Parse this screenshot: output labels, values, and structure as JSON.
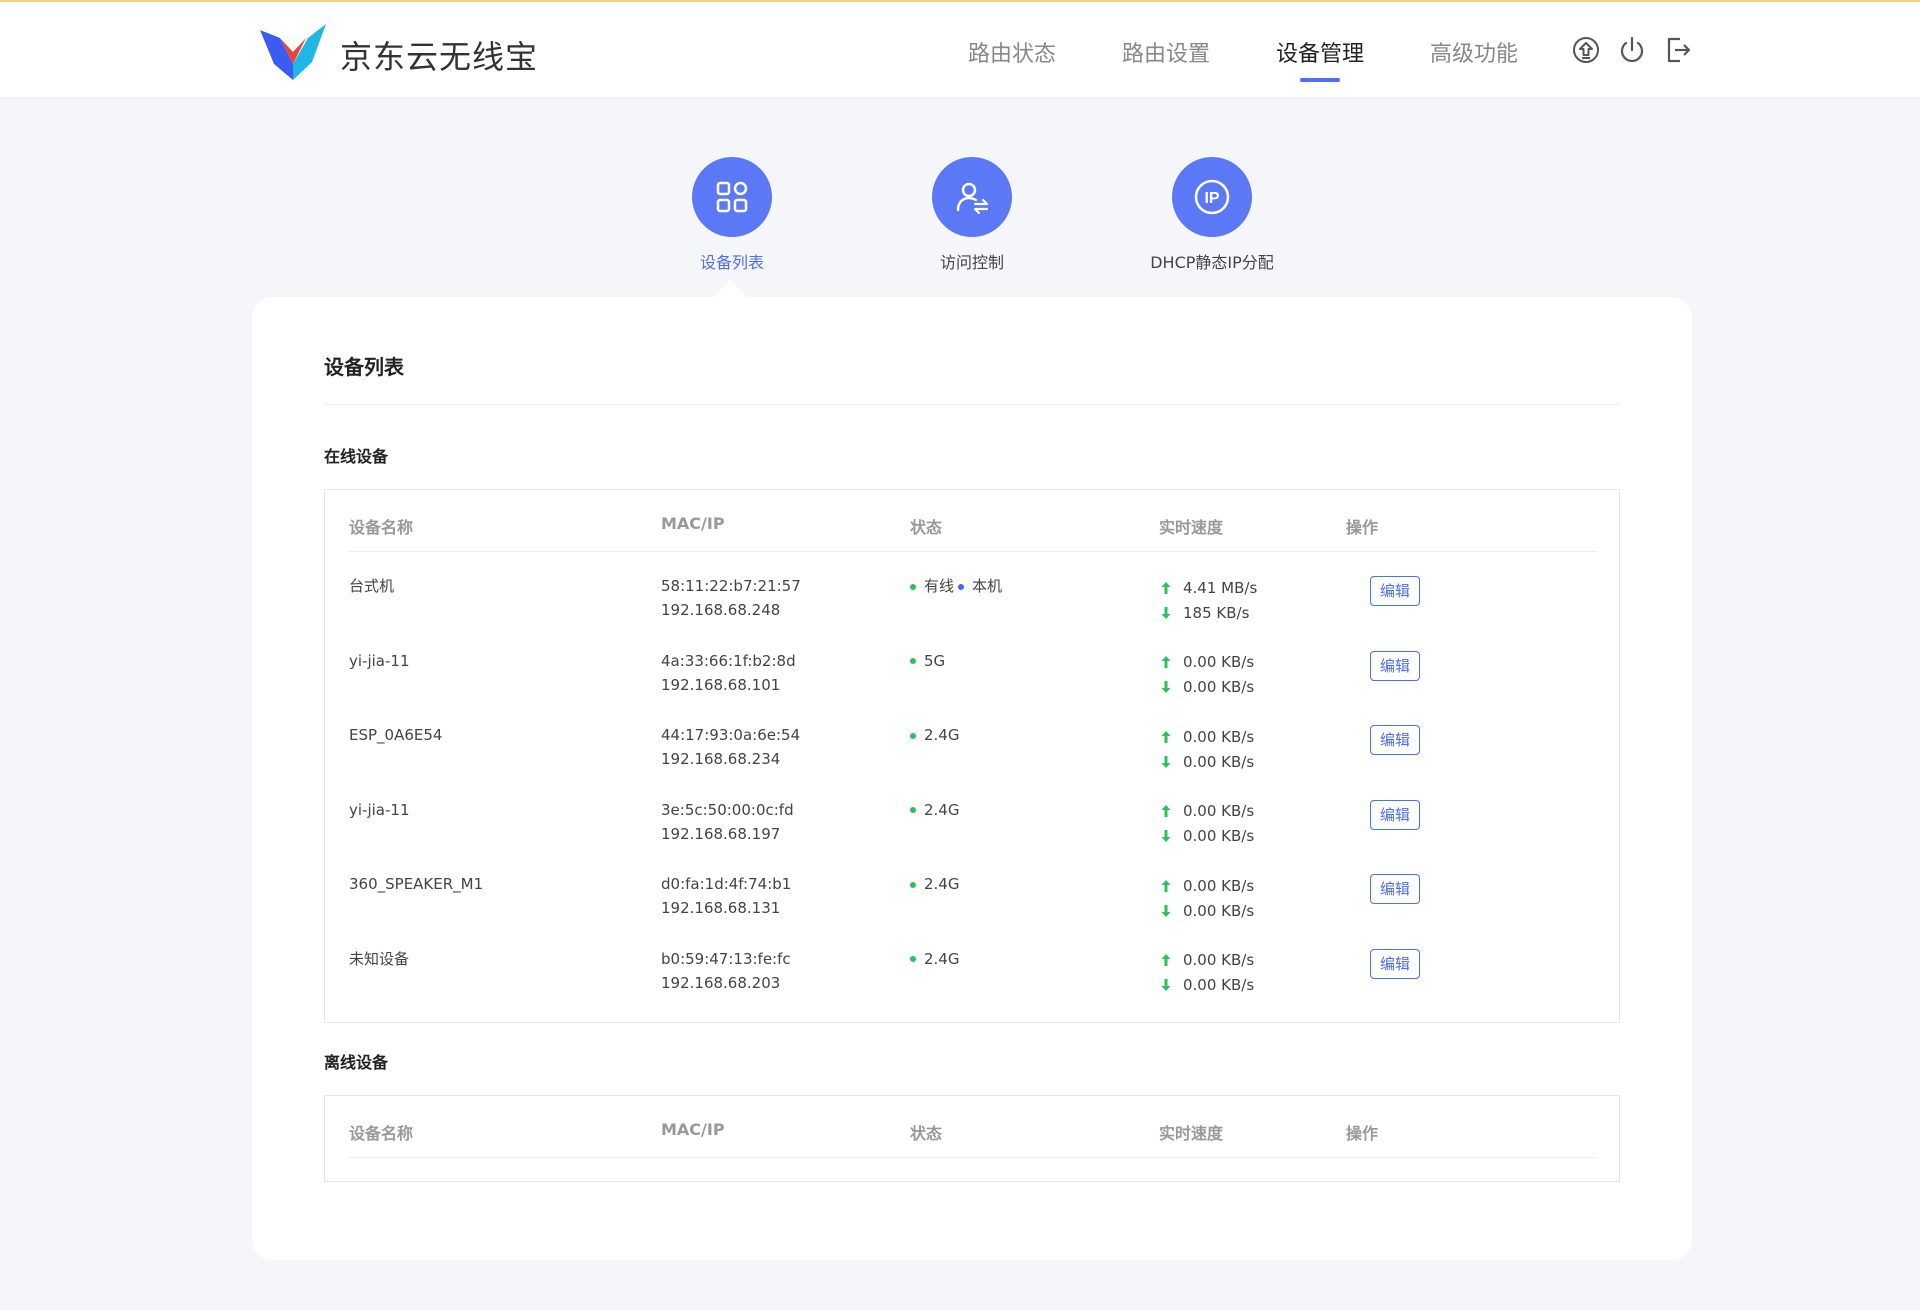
{
  "brand": {
    "name": "京东云无线宝"
  },
  "nav": {
    "items": [
      {
        "label": "路由状态",
        "active": false
      },
      {
        "label": "路由设置",
        "active": false
      },
      {
        "label": "设备管理",
        "active": true
      },
      {
        "label": "高级功能",
        "active": false
      }
    ]
  },
  "header_icons": [
    "upgrade-icon",
    "power-icon",
    "logout-icon"
  ],
  "subnav": {
    "items": [
      {
        "label": "设备列表",
        "icon": "grid-icon",
        "active": true
      },
      {
        "label": "访问控制",
        "icon": "user-switch-icon",
        "active": false
      },
      {
        "label": "DHCP静态IP分配",
        "icon": "ip-icon",
        "active": false
      }
    ]
  },
  "panel": {
    "title": "设备列表",
    "online_title": "在线设备",
    "offline_title": "离线设备",
    "columns": [
      "设备名称",
      "MAC/IP",
      "状态",
      "实时速度",
      "操作"
    ],
    "edit_label": "编辑",
    "online_devices": [
      {
        "name": "台式机",
        "mac": "58:11:22:b7:21:57",
        "ip": "192.168.68.248",
        "status": "有线",
        "status2": "本机",
        "up": "4.41 MB/s",
        "down": "185 KB/s"
      },
      {
        "name": "yi-jia-11",
        "mac": "4a:33:66:1f:b2:8d",
        "ip": "192.168.68.101",
        "status": "5G",
        "status2": "",
        "up": "0.00 KB/s",
        "down": "0.00 KB/s"
      },
      {
        "name": "ESP_0A6E54",
        "mac": "44:17:93:0a:6e:54",
        "ip": "192.168.68.234",
        "status": "2.4G",
        "status2": "",
        "up": "0.00 KB/s",
        "down": "0.00 KB/s"
      },
      {
        "name": "yi-jia-11",
        "mac": "3e:5c:50:00:0c:fd",
        "ip": "192.168.68.197",
        "status": "2.4G",
        "status2": "",
        "up": "0.00 KB/s",
        "down": "0.00 KB/s"
      },
      {
        "name": "360_SPEAKER_M1",
        "mac": "d0:fa:1d:4f:74:b1",
        "ip": "192.168.68.131",
        "status": "2.4G",
        "status2": "",
        "up": "0.00 KB/s",
        "down": "0.00 KB/s"
      },
      {
        "name": "未知设备",
        "mac": "b0:59:47:13:fe:fc",
        "ip": "192.168.68.203",
        "status": "2.4G",
        "status2": "",
        "up": "0.00 KB/s",
        "down": "0.00 KB/s"
      }
    ]
  },
  "colors": {
    "accent": "#4d6ef5",
    "icon_bg": "#5b78f6",
    "online": "#2bc25c",
    "local": "#3b6cf6"
  }
}
